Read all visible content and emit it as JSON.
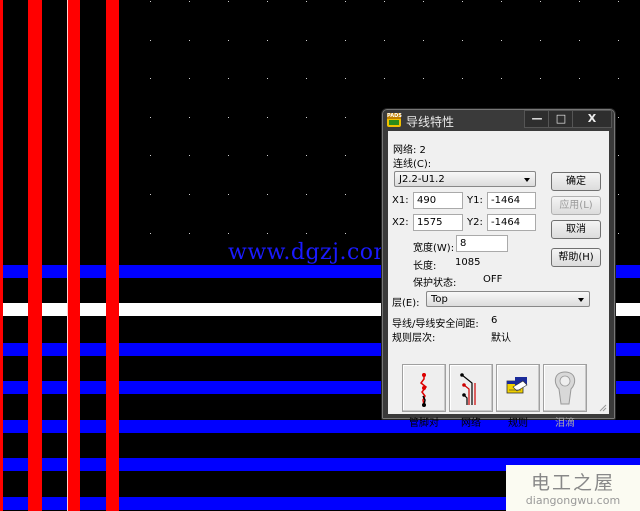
{
  "canvas": {
    "background": "#000000",
    "trace_colors": {
      "top_layer": "#ff0000",
      "bottom_layer": "#0000ff",
      "selected": "#ffffff"
    },
    "watermark_url": "www.dgzj.com"
  },
  "brand_watermark": {
    "chinese": "电工之屋",
    "english": "diangongwu.com"
  },
  "dialog": {
    "title": "导线特性",
    "app_icon_text": "PADS",
    "window_buttons": {
      "minimize": "—",
      "maximize": "□",
      "close": "X"
    },
    "net_label": "网络: 2",
    "connection_label": "连线(C):",
    "connection_value": "J2.2-U1.2",
    "x1_label": "X1:",
    "x1_value": "490",
    "y1_label": "Y1:",
    "y1_value": "-1464",
    "x2_label": "X2:",
    "x2_value": "1575",
    "y2_label": "Y2:",
    "y2_value": "-1464",
    "width_label": "宽度(W):",
    "width_value": "8",
    "length_label": "长度:",
    "length_value": "1085",
    "protect_label": "保护状态:",
    "protect_value": "OFF",
    "layer_label": "层(E):",
    "layer_value": "Top",
    "clearance_label": "导线/导线安全间距:",
    "clearance_value": "6",
    "rule_level_label": "规则层次:",
    "rule_level_value": "默认",
    "buttons": {
      "ok": "确定",
      "apply": "应用(L)",
      "cancel": "取消",
      "help": "帮助(H)"
    },
    "tool_buttons": [
      {
        "label": "管脚对",
        "icon": "pin-pair-icon",
        "enabled": true
      },
      {
        "label": "网络",
        "icon": "net-icon",
        "enabled": true
      },
      {
        "label": "规则",
        "icon": "rules-icon",
        "enabled": true
      },
      {
        "label": "泪滴",
        "icon": "teardrop-icon",
        "enabled": false
      }
    ]
  }
}
